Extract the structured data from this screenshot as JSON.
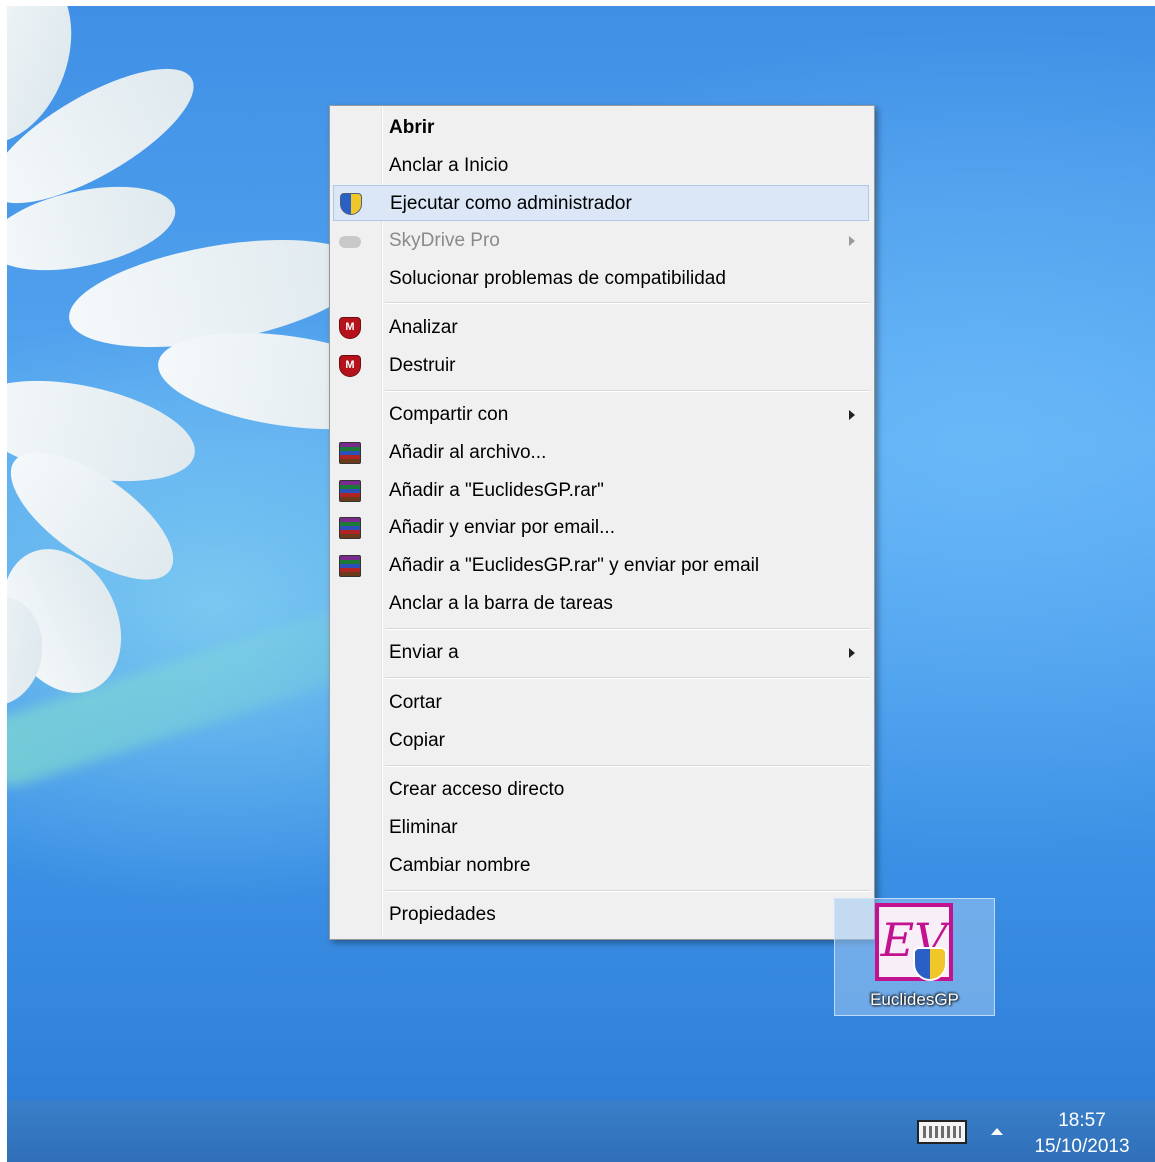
{
  "context_menu": {
    "items": [
      {
        "label": "Abrir",
        "bold": true,
        "icon": "",
        "submenu": false
      },
      {
        "label": "Anclar a Inicio",
        "icon": "",
        "submenu": false
      },
      {
        "label": "Ejecutar como administrador",
        "icon": "uac-shield-icon",
        "submenu": false,
        "highlighted": true
      },
      {
        "label": "SkyDrive Pro",
        "icon": "skydrive-cloud-icon",
        "submenu": true,
        "disabled": true
      },
      {
        "label": "Solucionar problemas de compatibilidad",
        "icon": "",
        "submenu": false
      },
      {
        "label": "Analizar",
        "icon": "mcafee-icon",
        "submenu": false
      },
      {
        "label": "Destruir",
        "icon": "mcafee-icon",
        "submenu": false
      },
      {
        "label": "Compartir con",
        "icon": "",
        "submenu": true
      },
      {
        "label": "Añadir al archivo...",
        "icon": "winrar-icon",
        "submenu": false
      },
      {
        "label": "Añadir a \"EuclidesGP.rar\"",
        "icon": "winrar-icon",
        "submenu": false
      },
      {
        "label": "Añadir y enviar por email...",
        "icon": "winrar-icon",
        "submenu": false
      },
      {
        "label": "Añadir a \"EuclidesGP.rar\" y enviar por email",
        "icon": "winrar-icon",
        "submenu": false
      },
      {
        "label": "Anclar a la barra de tareas",
        "icon": "",
        "submenu": false
      },
      {
        "label": "Enviar a",
        "icon": "",
        "submenu": true
      },
      {
        "label": "Cortar",
        "icon": "",
        "submenu": false
      },
      {
        "label": "Copiar",
        "icon": "",
        "submenu": false
      },
      {
        "label": "Crear acceso directo",
        "icon": "",
        "submenu": false
      },
      {
        "label": "Eliminar",
        "icon": "",
        "submenu": false
      },
      {
        "label": "Cambiar nombre",
        "icon": "",
        "submenu": false
      },
      {
        "label": "Propiedades",
        "icon": "",
        "submenu": false
      }
    ]
  },
  "desktop_icon": {
    "label": "EuclidesGP",
    "logo_text": "EV"
  },
  "taskbar": {
    "time": "18:57",
    "date": "15/10/2013"
  },
  "colors": {
    "highlight": "#dbe7f7",
    "menu_bg": "#f0f0f0",
    "desktop": "#4a9ae8",
    "taskbar": "#3576bf"
  }
}
